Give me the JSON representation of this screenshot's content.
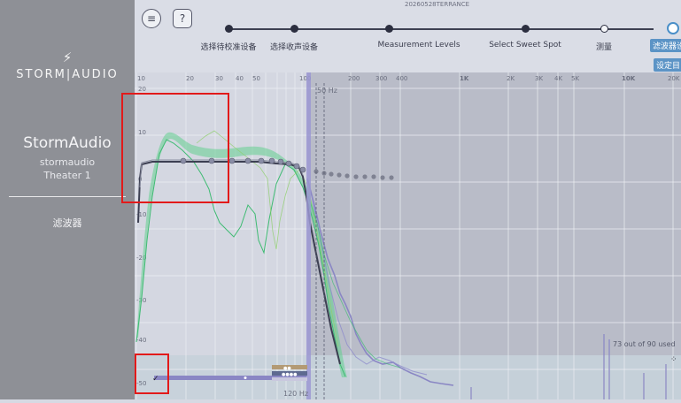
{
  "sidebar": {
    "logo_bolt": "⚡",
    "logo": "STORM|AUDIO",
    "device_name": "StormAudio",
    "device_sub1": "stormaudio",
    "device_sub2": "Theater 1",
    "menu_item": "滤波器"
  },
  "topbar": {
    "menu_icon": "≡",
    "help_icon": "?",
    "title": "20260528TERRANCE",
    "steps": [
      {
        "label": "选择待校准设备"
      },
      {
        "label": "选择收声设备"
      },
      {
        "label": "Measurement Levels"
      },
      {
        "label": "Select Sweet Spot"
      },
      {
        "label": "测量"
      },
      {
        "label": "滤波器设"
      }
    ],
    "sub_tag": "设定目"
  },
  "chart": {
    "x_ticks": [
      "10",
      "20",
      "30",
      "40",
      "50",
      "100",
      "200",
      "300",
      "400",
      "1K",
      "2K",
      "3K",
      "4K",
      "5K",
      "10K",
      "20K"
    ],
    "y_ticks": [
      "20",
      "10",
      "0",
      "-10",
      "-20",
      "-30",
      "-40",
      "-50"
    ],
    "cursor_label": "50 Hz",
    "crossover_label": "120 Hz",
    "usage": "73 out of 90 used",
    "colors": {
      "green": "#45c07a",
      "purple": "#8a87c4",
      "target": "#3c3f52",
      "panel": "#b8bcc8"
    }
  }
}
